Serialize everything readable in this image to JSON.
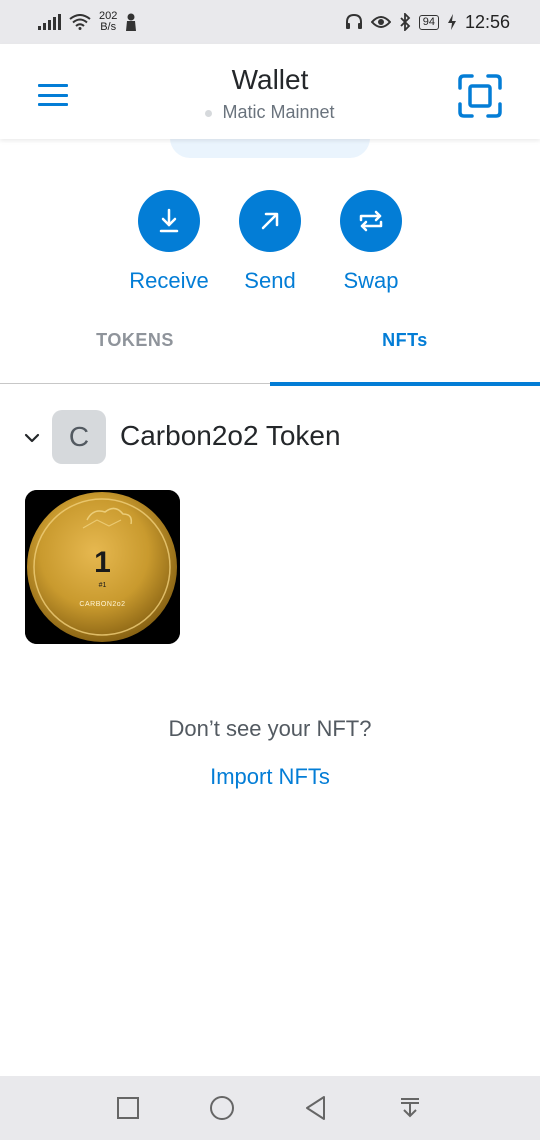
{
  "status_bar": {
    "speed_value": "202",
    "speed_unit": "B/s",
    "battery": "94",
    "time": "12:56"
  },
  "header": {
    "title": "Wallet",
    "network": "Matic Mainnet"
  },
  "actions": [
    {
      "label": "Receive",
      "icon": "arrow-down-to-line-icon"
    },
    {
      "label": "Send",
      "icon": "arrow-up-right-icon"
    },
    {
      "label": "Swap",
      "icon": "swap-arrows-icon"
    }
  ],
  "tabs": {
    "tokens": "TOKENS",
    "nfts": "NFTs",
    "active": "nfts"
  },
  "collection": {
    "avatar_letter": "C",
    "name": "Carbon2o2 Token"
  },
  "nft": {
    "number": "1",
    "id_label": "#1",
    "brand": "CARBON2o2"
  },
  "empty_state": {
    "question": "Don’t see your NFT?",
    "import_link": "Import NFTs"
  },
  "colors": {
    "primary": "#037dd6",
    "status_bar_bg": "#e9e9ec",
    "avatar_bg": "#d6d9dc",
    "coin_gold": "#c99a2e"
  }
}
